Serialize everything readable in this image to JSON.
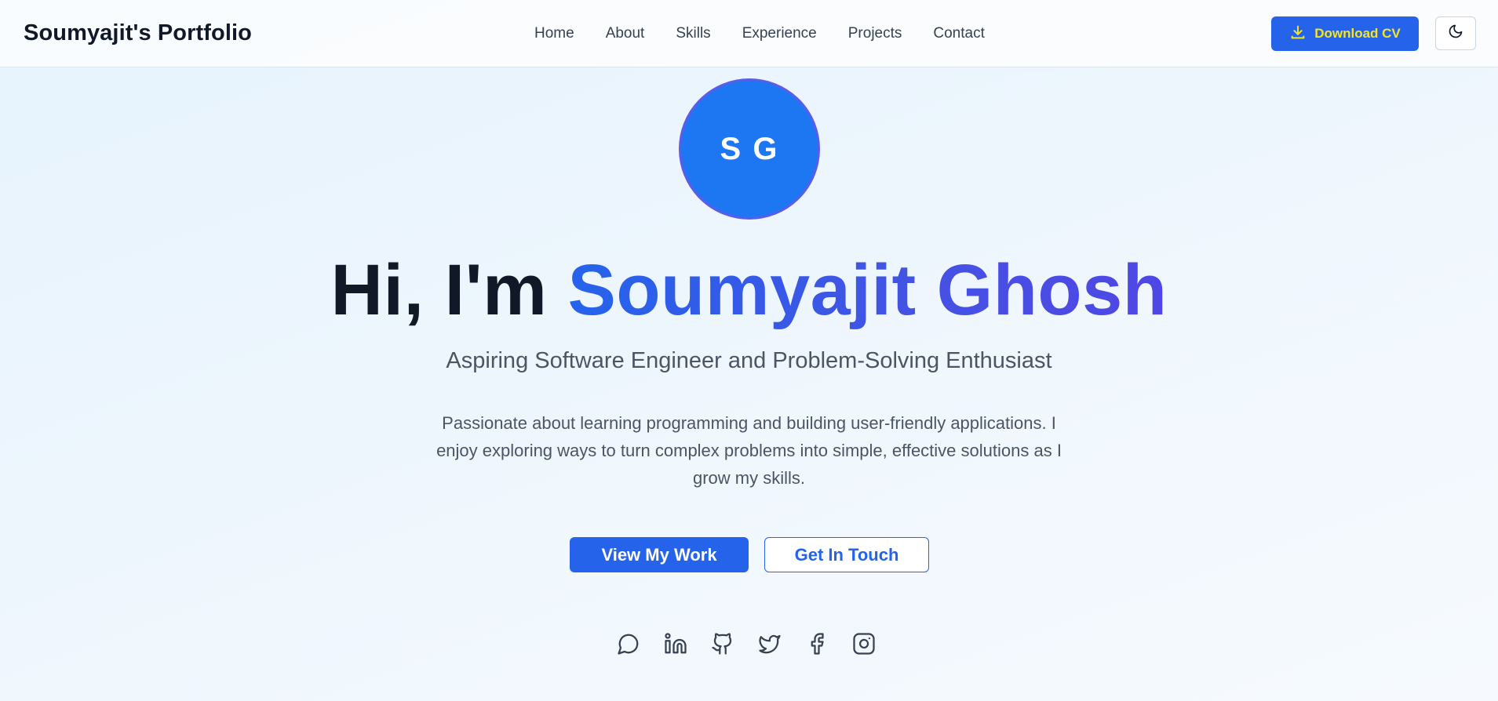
{
  "navbar": {
    "brand": "Soumyajit's Portfolio",
    "links": [
      "Home",
      "About",
      "Skills",
      "Experience",
      "Projects",
      "Contact"
    ],
    "download_cv_label": "Download CV",
    "download_icon": "download-icon",
    "theme_icon": "moon-icon"
  },
  "hero": {
    "avatar_initials": "S G",
    "greeting": "Hi, I'm",
    "name": "Soumyajit Ghosh",
    "subtitle": "Aspiring Software Engineer and Problem-Solving Enthusiast",
    "description": "Passionate about learning programming and building user-friendly applications. I enjoy exploring ways to turn complex problems into simple, effective solutions as I grow my skills.",
    "primary_button": "View My Work",
    "secondary_button": "Get In Touch"
  },
  "socials": [
    "message-circle-icon",
    "linkedin-icon",
    "github-icon",
    "twitter-icon",
    "facebook-icon",
    "instagram-icon"
  ],
  "colors": {
    "accent": "#2563eb",
    "gradient_end": "#4f46e5",
    "cv_text": "#f5e52a",
    "avatar_bg": "#1d77f2"
  }
}
